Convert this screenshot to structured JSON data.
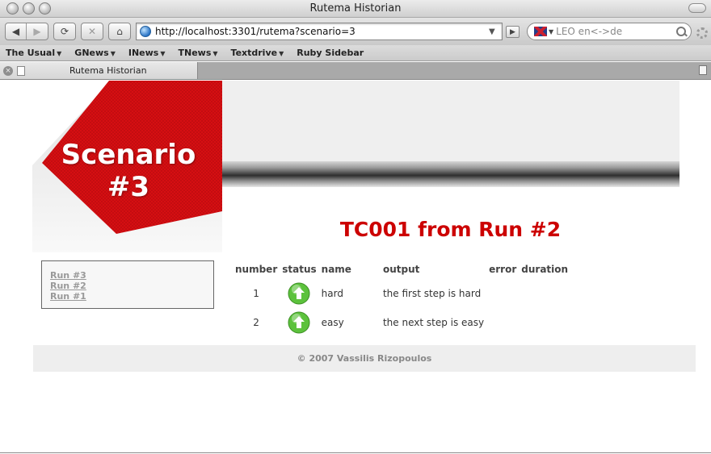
{
  "window": {
    "title": "Rutema Historian"
  },
  "toolbar": {
    "url": "http://localhost:3301/rutema?scenario=3",
    "search_placeholder": "LEO en<->de"
  },
  "bookmarks": [
    {
      "label": "The Usual",
      "dropdown": true
    },
    {
      "label": "GNews",
      "dropdown": true
    },
    {
      "label": "INews",
      "dropdown": true
    },
    {
      "label": "TNews",
      "dropdown": true
    },
    {
      "label": "Textdrive",
      "dropdown": true
    },
    {
      "label": "Ruby Sidebar",
      "dropdown": false
    }
  ],
  "tab": {
    "label": "Rutema Historian"
  },
  "page": {
    "logo_line1": "Scenario",
    "logo_line2": "#3",
    "heading": "TC001 from Run #2",
    "runs": [
      "Run #3",
      "Run #2",
      "Run #1"
    ],
    "table": {
      "headers": [
        "number",
        "status",
        "name",
        "output",
        "error",
        "duration"
      ],
      "rows": [
        {
          "number": "1",
          "status": "success",
          "name": "hard",
          "output": "the first step is hard",
          "error": "",
          "duration": ""
        },
        {
          "number": "2",
          "status": "success",
          "name": "easy",
          "output": "the next step is easy",
          "error": "",
          "duration": ""
        }
      ]
    },
    "footer": "© 2007 Vassilis Rizopoulos"
  },
  "colors": {
    "accent": "#cc0000",
    "logo_red": "#d40f12",
    "status_green": "#5cc23c"
  }
}
